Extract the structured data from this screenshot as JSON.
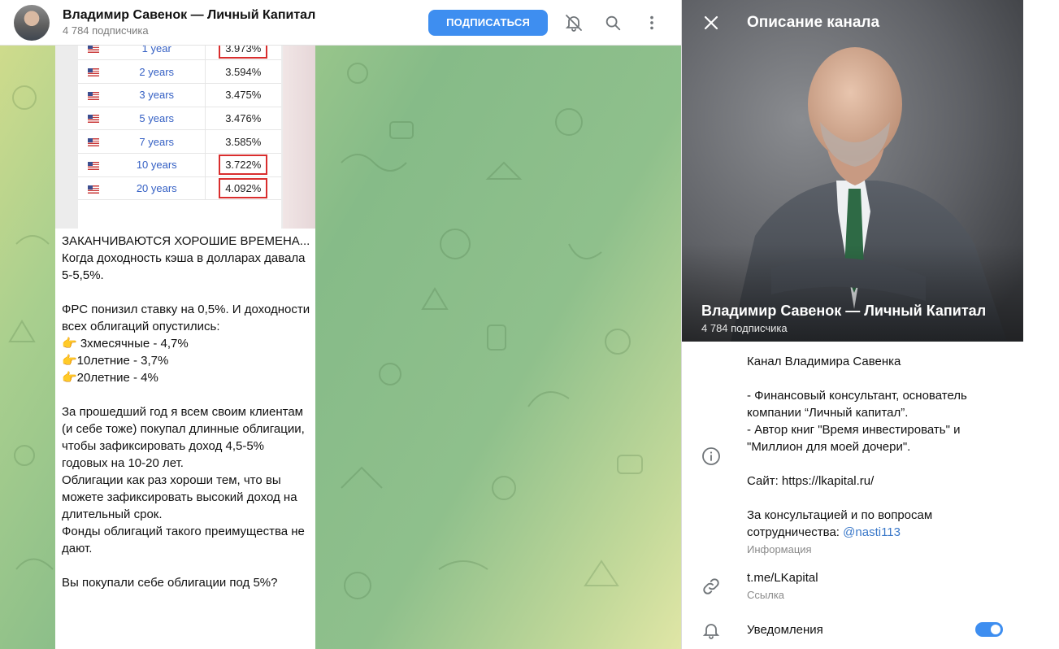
{
  "header": {
    "title": "Владимир Савенок — Личный Капитал",
    "subscribers": "4 784 подписчика",
    "subscribe_label": "ПОДПИСАТЬСЯ",
    "icons": [
      "bell-off-icon",
      "search-icon",
      "more-vertical-icon"
    ]
  },
  "message": {
    "table": [
      {
        "term": "1 year",
        "value": "3.973%",
        "highlight": true
      },
      {
        "term": "2 years",
        "value": "3.594%",
        "highlight": false
      },
      {
        "term": "3 years",
        "value": "3.475%",
        "highlight": false
      },
      {
        "term": "5 years",
        "value": "3.476%",
        "highlight": false
      },
      {
        "term": "7 years",
        "value": "3.585%",
        "highlight": false
      },
      {
        "term": "10 years",
        "value": "3.722%",
        "highlight": true
      },
      {
        "term": "20 years",
        "value": "4.092%",
        "highlight": true
      }
    ],
    "lines": [
      "ЗАКАНЧИВАЮТСЯ ХОРОШИЕ ВРЕМЕНА...",
      "Когда доходность кэша в долларах давала 5-5,5%.",
      "",
      "ФРС понизил ставку на 0,5%. И доходности всех облигаций опустились:",
      "👉 3хмесячные - 4,7%",
      "👉10летние - 3,7%",
      "👉20летние - 4%",
      "",
      "За прошедший год я всем своим клиентам (и себе тоже) покупал длинные облигации, чтобы зафиксировать доход 4,5-5% годовых на 10-20 лет.",
      "Облигации как раз хороши тем, что вы можете зафиксировать высокий доход на длительный срок.",
      "Фонды облигаций такого преимущества не дают.",
      "",
      "Вы покупали себе облигации под 5%?"
    ]
  },
  "panel": {
    "heading": "Описание канала",
    "photo_title": "Владимир Савенок — Личный Капитал",
    "photo_subs": "4 784 подписчика",
    "about_lines": [
      "Канал Владимира Савенка",
      "",
      "- Финансовый консультант, основатель компании “Личный капитал”.",
      "- Автор книг \"Время инвестировать\" и \"Миллион для моей дочери\".",
      "",
      "Сайт: https://lkapital.ru/",
      "",
      "За консультацией и по вопросам сотрудничества: "
    ],
    "about_mention": "@nasti113",
    "about_caption": "Информация",
    "link": "t.me/LKapital",
    "link_caption": "Ссылка",
    "notifications_label": "Уведомления",
    "notifications_on": true
  },
  "colors": {
    "accent": "#3e8ef0",
    "highlight_box": "#d92e2e",
    "link_blue": "#3a78c9"
  }
}
